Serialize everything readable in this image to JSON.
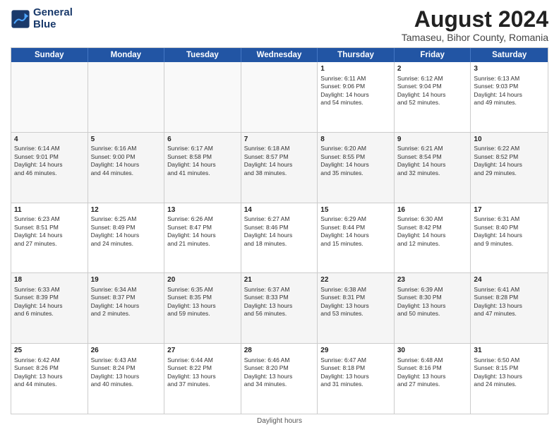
{
  "header": {
    "logo_line1": "General",
    "logo_line2": "Blue",
    "month_title": "August 2024",
    "location": "Tamaseu, Bihor County, Romania"
  },
  "day_headers": [
    "Sunday",
    "Monday",
    "Tuesday",
    "Wednesday",
    "Thursday",
    "Friday",
    "Saturday"
  ],
  "footer": {
    "daylight_label": "Daylight hours"
  },
  "weeks": [
    [
      {
        "day": "",
        "info": ""
      },
      {
        "day": "",
        "info": ""
      },
      {
        "day": "",
        "info": ""
      },
      {
        "day": "",
        "info": ""
      },
      {
        "day": "1",
        "info": "Sunrise: 6:11 AM\nSunset: 9:06 PM\nDaylight: 14 hours\nand 54 minutes."
      },
      {
        "day": "2",
        "info": "Sunrise: 6:12 AM\nSunset: 9:04 PM\nDaylight: 14 hours\nand 52 minutes."
      },
      {
        "day": "3",
        "info": "Sunrise: 6:13 AM\nSunset: 9:03 PM\nDaylight: 14 hours\nand 49 minutes."
      }
    ],
    [
      {
        "day": "4",
        "info": "Sunrise: 6:14 AM\nSunset: 9:01 PM\nDaylight: 14 hours\nand 46 minutes."
      },
      {
        "day": "5",
        "info": "Sunrise: 6:16 AM\nSunset: 9:00 PM\nDaylight: 14 hours\nand 44 minutes."
      },
      {
        "day": "6",
        "info": "Sunrise: 6:17 AM\nSunset: 8:58 PM\nDaylight: 14 hours\nand 41 minutes."
      },
      {
        "day": "7",
        "info": "Sunrise: 6:18 AM\nSunset: 8:57 PM\nDaylight: 14 hours\nand 38 minutes."
      },
      {
        "day": "8",
        "info": "Sunrise: 6:20 AM\nSunset: 8:55 PM\nDaylight: 14 hours\nand 35 minutes."
      },
      {
        "day": "9",
        "info": "Sunrise: 6:21 AM\nSunset: 8:54 PM\nDaylight: 14 hours\nand 32 minutes."
      },
      {
        "day": "10",
        "info": "Sunrise: 6:22 AM\nSunset: 8:52 PM\nDaylight: 14 hours\nand 29 minutes."
      }
    ],
    [
      {
        "day": "11",
        "info": "Sunrise: 6:23 AM\nSunset: 8:51 PM\nDaylight: 14 hours\nand 27 minutes."
      },
      {
        "day": "12",
        "info": "Sunrise: 6:25 AM\nSunset: 8:49 PM\nDaylight: 14 hours\nand 24 minutes."
      },
      {
        "day": "13",
        "info": "Sunrise: 6:26 AM\nSunset: 8:47 PM\nDaylight: 14 hours\nand 21 minutes."
      },
      {
        "day": "14",
        "info": "Sunrise: 6:27 AM\nSunset: 8:46 PM\nDaylight: 14 hours\nand 18 minutes."
      },
      {
        "day": "15",
        "info": "Sunrise: 6:29 AM\nSunset: 8:44 PM\nDaylight: 14 hours\nand 15 minutes."
      },
      {
        "day": "16",
        "info": "Sunrise: 6:30 AM\nSunset: 8:42 PM\nDaylight: 14 hours\nand 12 minutes."
      },
      {
        "day": "17",
        "info": "Sunrise: 6:31 AM\nSunset: 8:40 PM\nDaylight: 14 hours\nand 9 minutes."
      }
    ],
    [
      {
        "day": "18",
        "info": "Sunrise: 6:33 AM\nSunset: 8:39 PM\nDaylight: 14 hours\nand 6 minutes."
      },
      {
        "day": "19",
        "info": "Sunrise: 6:34 AM\nSunset: 8:37 PM\nDaylight: 14 hours\nand 2 minutes."
      },
      {
        "day": "20",
        "info": "Sunrise: 6:35 AM\nSunset: 8:35 PM\nDaylight: 13 hours\nand 59 minutes."
      },
      {
        "day": "21",
        "info": "Sunrise: 6:37 AM\nSunset: 8:33 PM\nDaylight: 13 hours\nand 56 minutes."
      },
      {
        "day": "22",
        "info": "Sunrise: 6:38 AM\nSunset: 8:31 PM\nDaylight: 13 hours\nand 53 minutes."
      },
      {
        "day": "23",
        "info": "Sunrise: 6:39 AM\nSunset: 8:30 PM\nDaylight: 13 hours\nand 50 minutes."
      },
      {
        "day": "24",
        "info": "Sunrise: 6:41 AM\nSunset: 8:28 PM\nDaylight: 13 hours\nand 47 minutes."
      }
    ],
    [
      {
        "day": "25",
        "info": "Sunrise: 6:42 AM\nSunset: 8:26 PM\nDaylight: 13 hours\nand 44 minutes."
      },
      {
        "day": "26",
        "info": "Sunrise: 6:43 AM\nSunset: 8:24 PM\nDaylight: 13 hours\nand 40 minutes."
      },
      {
        "day": "27",
        "info": "Sunrise: 6:44 AM\nSunset: 8:22 PM\nDaylight: 13 hours\nand 37 minutes."
      },
      {
        "day": "28",
        "info": "Sunrise: 6:46 AM\nSunset: 8:20 PM\nDaylight: 13 hours\nand 34 minutes."
      },
      {
        "day": "29",
        "info": "Sunrise: 6:47 AM\nSunset: 8:18 PM\nDaylight: 13 hours\nand 31 minutes."
      },
      {
        "day": "30",
        "info": "Sunrise: 6:48 AM\nSunset: 8:16 PM\nDaylight: 13 hours\nand 27 minutes."
      },
      {
        "day": "31",
        "info": "Sunrise: 6:50 AM\nSunset: 8:15 PM\nDaylight: 13 hours\nand 24 minutes."
      }
    ]
  ]
}
